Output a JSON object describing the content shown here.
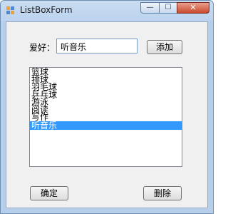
{
  "window": {
    "title": "ListBoxForm",
    "controls": {
      "minimize": "—",
      "maximize": "☐",
      "close": "✕"
    }
  },
  "form": {
    "hobby_label": "爱好：",
    "hobby_input_value": "听音乐",
    "add_button": "添加",
    "ok_button": "确定",
    "delete_button": "删除"
  },
  "listbox": {
    "items": [
      "篮球",
      "排球",
      "羽毛球",
      "乒乓球",
      "游泳",
      "阅读",
      "写作",
      "听音乐"
    ],
    "selected_index": 7
  },
  "colors": {
    "selection": "#3399ff",
    "titlebar": "#bdd3ee",
    "client": "#f0f0f0"
  }
}
